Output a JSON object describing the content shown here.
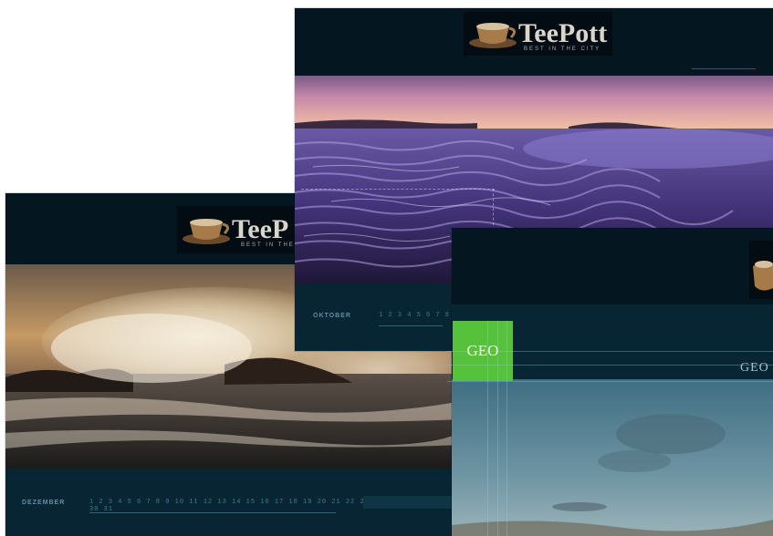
{
  "brand": {
    "name": "TeePott",
    "name_left": "TeeP",
    "tagline": "BEST IN THE CITY"
  },
  "calendars": {
    "left": {
      "month": "DEZEMBER",
      "days": "1 2 3 4 5 6 7 8 9 10 11 12 13 14 15 16 17 18 19 20 21 22 23 24 25 26 27 28 29 30 31"
    },
    "top": {
      "month": "OKTOBER",
      "days": "1 2 3 4 5 6 7 8 9"
    }
  },
  "geo": {
    "badge": "GEO",
    "right_label": "GEO"
  },
  "colors": {
    "card_bg": "#082533",
    "header_bg": "#041721",
    "geo_green": "#56c23b"
  }
}
